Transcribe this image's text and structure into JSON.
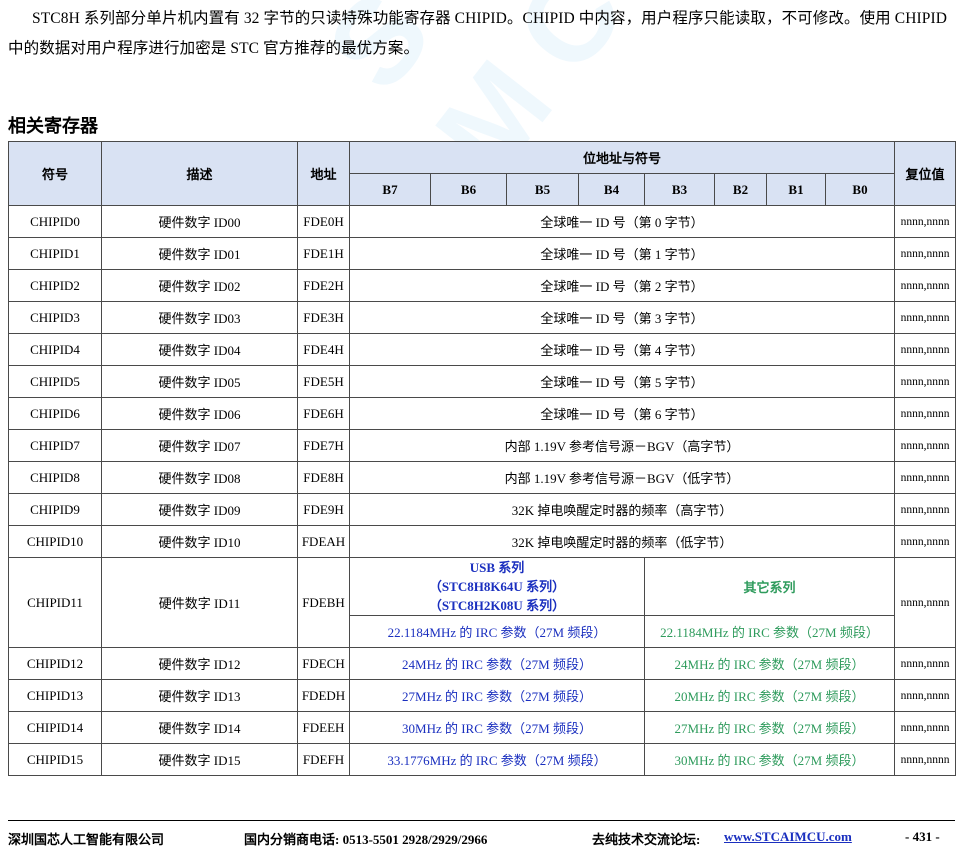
{
  "intro": "STC8H 系列部分单片机内置有 32 字节的只读特殊功能寄存器 CHIPID。CHIPID 中内容，用户程序只能读取，不可修改。使用 CHIPID 中的数据对用户程序进行加密是 STC 官方推荐的最优方案。",
  "section_title": "相关寄存器",
  "watermark": "STC MCU",
  "table": {
    "headers": {
      "symbol": "符号",
      "desc": "描述",
      "addr": "地址",
      "bits_group": "位地址与符号",
      "reset": "复位值",
      "bits": [
        "B7",
        "B6",
        "B5",
        "B4",
        "B3",
        "B2",
        "B1",
        "B0"
      ]
    },
    "rows": [
      {
        "symbol": "CHIPID0",
        "desc": "硬件数字 ID00",
        "addr": "FDE0H",
        "content": "全球唯一 ID 号（第 0 字节）",
        "reset": "nnnn,nnnn"
      },
      {
        "symbol": "CHIPID1",
        "desc": "硬件数字 ID01",
        "addr": "FDE1H",
        "content": "全球唯一 ID 号（第 1 字节）",
        "reset": "nnnn,nnnn"
      },
      {
        "symbol": "CHIPID2",
        "desc": "硬件数字 ID02",
        "addr": "FDE2H",
        "content": "全球唯一 ID 号（第 2 字节）",
        "reset": "nnnn,nnnn"
      },
      {
        "symbol": "CHIPID3",
        "desc": "硬件数字 ID03",
        "addr": "FDE3H",
        "content": "全球唯一 ID 号（第 3 字节）",
        "reset": "nnnn,nnnn"
      },
      {
        "symbol": "CHIPID4",
        "desc": "硬件数字 ID04",
        "addr": "FDE4H",
        "content": "全球唯一 ID 号（第 4 字节）",
        "reset": "nnnn,nnnn"
      },
      {
        "symbol": "CHIPID5",
        "desc": "硬件数字 ID05",
        "addr": "FDE5H",
        "content": "全球唯一 ID 号（第 5 字节）",
        "reset": "nnnn,nnnn"
      },
      {
        "symbol": "CHIPID6",
        "desc": "硬件数字 ID06",
        "addr": "FDE6H",
        "content": "全球唯一 ID 号（第 6 字节）",
        "reset": "nnnn,nnnn"
      },
      {
        "symbol": "CHIPID7",
        "desc": "硬件数字 ID07",
        "addr": "FDE7H",
        "content": "内部 1.19V 参考信号源－BGV（高字节）",
        "reset": "nnnn,nnnn"
      },
      {
        "symbol": "CHIPID8",
        "desc": "硬件数字 ID08",
        "addr": "FDE8H",
        "content": "内部 1.19V 参考信号源－BGV（低字节）",
        "reset": "nnnn,nnnn"
      },
      {
        "symbol": "CHIPID9",
        "desc": "硬件数字 ID09",
        "addr": "FDE9H",
        "content": "32K 掉电唤醒定时器的频率（高字节）",
        "reset": "nnnn,nnnn"
      },
      {
        "symbol": "CHIPID10",
        "desc": "硬件数字 ID10",
        "addr": "FDEAH",
        "content": "32K 掉电唤醒定时器的频率（低字节）",
        "reset": "nnnn,nnnn"
      }
    ],
    "row11": {
      "symbol": "CHIPID11",
      "desc": "硬件数字 ID11",
      "addr": "FDEBH",
      "reset": "nnnn,nnnn",
      "usb_head_1": "USB 系列",
      "usb_head_2": "（STC8H8K64U 系列）",
      "usb_head_3": "（STC8H2K08U 系列）",
      "other_head": "其它系列",
      "usb_value": "22.1184MHz 的 IRC 参数（27M 频段）",
      "other_value": "22.1184MHz 的 IRC 参数（27M 频段）"
    },
    "split_rows": [
      {
        "symbol": "CHIPID12",
        "desc": "硬件数字 ID12",
        "addr": "FDECH",
        "usb": "24MHz 的 IRC 参数（27M 频段）",
        "other": "24MHz 的 IRC 参数（27M 频段）",
        "reset": "nnnn,nnnn"
      },
      {
        "symbol": "CHIPID13",
        "desc": "硬件数字 ID13",
        "addr": "FDEDH",
        "usb": "27MHz 的 IRC 参数（27M 频段）",
        "other": "20MHz 的 IRC 参数（27M 频段）",
        "reset": "nnnn,nnnn"
      },
      {
        "symbol": "CHIPID14",
        "desc": "硬件数字 ID14",
        "addr": "FDEEH",
        "usb": "30MHz 的 IRC 参数（27M 频段）",
        "other": "27MHz 的 IRC 参数（27M 频段）",
        "reset": "nnnn,nnnn"
      },
      {
        "symbol": "CHIPID15",
        "desc": "硬件数字 ID15",
        "addr": "FDEFH",
        "usb": "33.1776MHz 的 IRC 参数（27M 频段）",
        "other": "30MHz 的 IRC 参数（27M 频段）",
        "reset": "nnnn,nnnn"
      }
    ]
  },
  "footer": {
    "company": "深圳国芯人工智能有限公司",
    "phone": "国内分销商电话: 0513-5501 2928/2929/2966",
    "forum_label": "去纯技术交流论坛:",
    "forum_link": "www.STCAIMCU.com",
    "page": "- 431 -"
  },
  "colors": {
    "header_bg": "#d9e2f3",
    "usb_blue": "#1a2fbf",
    "other_green": "#2e9b5c"
  }
}
